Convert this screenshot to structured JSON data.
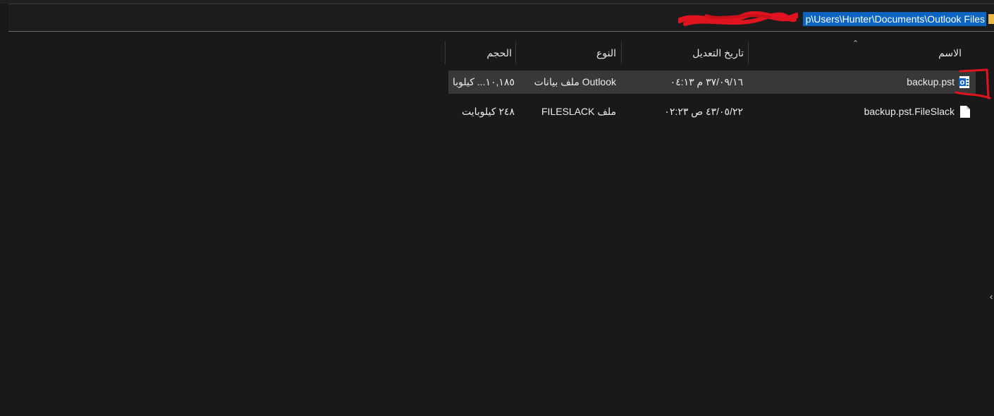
{
  "address_bar": {
    "path_visible": "p\\Users\\Hunter\\Documents\\Outlook Files"
  },
  "columns": {
    "name": "الاسم",
    "modified": "تاريخ التعديل",
    "type": "النوع",
    "size": "الحجم"
  },
  "files": [
    {
      "name": "backup.pst",
      "modified": "٣٧/٠٩/١٦ م ٠٤:١٣",
      "type": "Outlook ملف بيانات",
      "size": "١٠,١٨٥... كيلوبا",
      "icon": "outlook-data-file-icon",
      "selected": true
    },
    {
      "name": "backup.pst.FileSlack",
      "modified": "٤٣/٠٥/٢٢ ص ٠٢:٢٣",
      "type": "ملف FILESLACK",
      "size": "٢٤٨ كيلوبايت",
      "icon": "generic-file-icon",
      "selected": false
    }
  ],
  "colors": {
    "background": "#191919",
    "selection": "#0b64c0",
    "annotation_red": "#e0141e",
    "row_selected": "#383838"
  }
}
